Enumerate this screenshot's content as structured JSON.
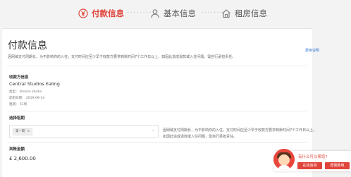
{
  "steps": [
    {
      "label": "付款信息",
      "icon": "yen-circle-icon",
      "active": true
    },
    {
      "label": "基本信息",
      "icon": "user-icon",
      "active": false
    },
    {
      "label": "租房信息",
      "icon": "house-icon",
      "active": false
    }
  ],
  "step_separator": "········",
  "page": {
    "title": "付款信息",
    "note": "因网域支付周期长，为不影响你的入住，支付时间应至少早于收款方要求到账时间7个工作日以上，如因此造成退款或入住问题，需自行承担责任。",
    "help_link": "费用说明"
  },
  "property": {
    "section_label": "收款方信息",
    "name": "Central Studios Ealing",
    "meta": [
      "类型： Bronze Studio",
      "起租日期： 2019-09-14",
      "租期： 51周"
    ]
  },
  "term": {
    "section_label": "选择租期",
    "selected": "第一期",
    "remove_glyph": "⊗",
    "side_note": "因网域支付周期长，为不影响你的入住，支付时间应至少早于收款方要求到账时间7个工作日以上，如因此造成退款或入住问题，需自行承担责任。"
  },
  "amount": {
    "section_label": "到账金额",
    "value": "£ 2,600.00"
  },
  "support": {
    "question": "有什么可以帮您?",
    "chat_button": "在线咨询",
    "call_button": "帮我致电"
  },
  "colors": {
    "accent": "#e0453c",
    "link": "#3a7bd5"
  }
}
